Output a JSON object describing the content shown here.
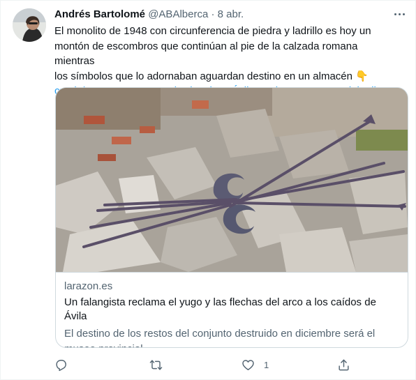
{
  "tweet": {
    "author_name": "Andrés Bartolomé",
    "handle": "@ABAlberca",
    "separator": "·",
    "date": "8 abr.",
    "text_line1": "El monolito de 1948 con circunferencia de piedra y ladrillo es hoy un",
    "text_line2": "montón de escombros que continúan al pie de la calzada romana mientras",
    "text_line3": "los símbolos que lo adornaban aguardan destino en un almacén 👇",
    "link_url": "cutt.ly/cFsPWmu",
    "hashtags": [
      "#MemoriaHistorica",
      "#Ávila",
      "#Falange",
      "#CuevasdelValle"
    ]
  },
  "card": {
    "domain": "larazon.es",
    "title": "Un falangista reclama el yugo y las flechas del arco a los caídos de Ávila",
    "description": "El destino de los restos del conjunto destruido en diciembre será el museo provincial"
  },
  "actions": {
    "reply_icon": "reply-icon",
    "retweet_icon": "retweet-icon",
    "like_icon": "heart-icon",
    "like_count": "1",
    "share_icon": "share-icon"
  },
  "colors": {
    "link": "#1d9bf0",
    "secondary_text": "#536471",
    "border": "#cfd9de"
  }
}
